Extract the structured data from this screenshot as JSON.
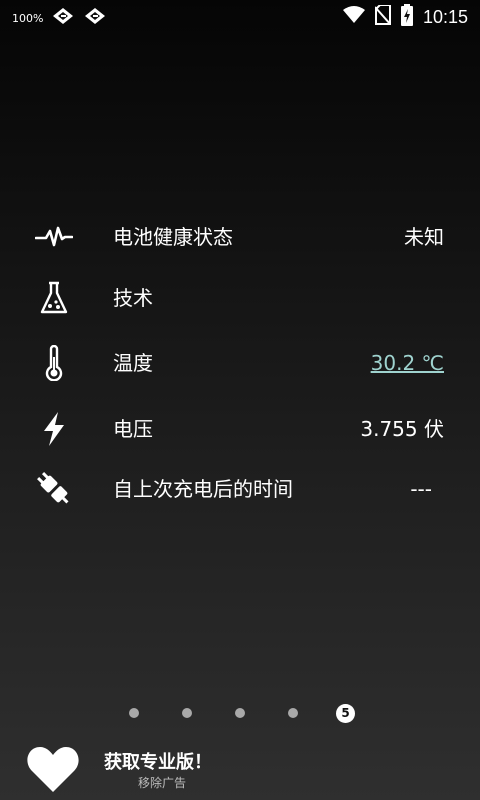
{
  "status_bar": {
    "battery_percent_label": "100%",
    "time": "10:15",
    "icons": [
      "notification-icon",
      "notification-icon",
      "wifi-icon",
      "no-sim-icon",
      "battery-charging-icon"
    ]
  },
  "rows": [
    {
      "icon": "heartbeat-icon",
      "label": "电池健康状态",
      "value": "未知"
    },
    {
      "icon": "flask-icon",
      "label": "技术",
      "value": ""
    },
    {
      "icon": "thermometer-icon",
      "label": "温度",
      "value": "30.2 ℃"
    },
    {
      "icon": "lightning-icon",
      "label": "电压",
      "value": "3.755 伏"
    },
    {
      "icon": "plug-icon",
      "label": "自上次充电后的时间",
      "value": "---"
    }
  ],
  "pager": {
    "current_page_label": "5",
    "total": 5
  },
  "promo": {
    "icon": "heart-icon",
    "title": "获取专业版！",
    "subtitle": "移除广告"
  },
  "colors": {
    "link_value": "#9fd3cf",
    "dot_inactive": "#a9a9a9",
    "text": "#ffffff"
  }
}
